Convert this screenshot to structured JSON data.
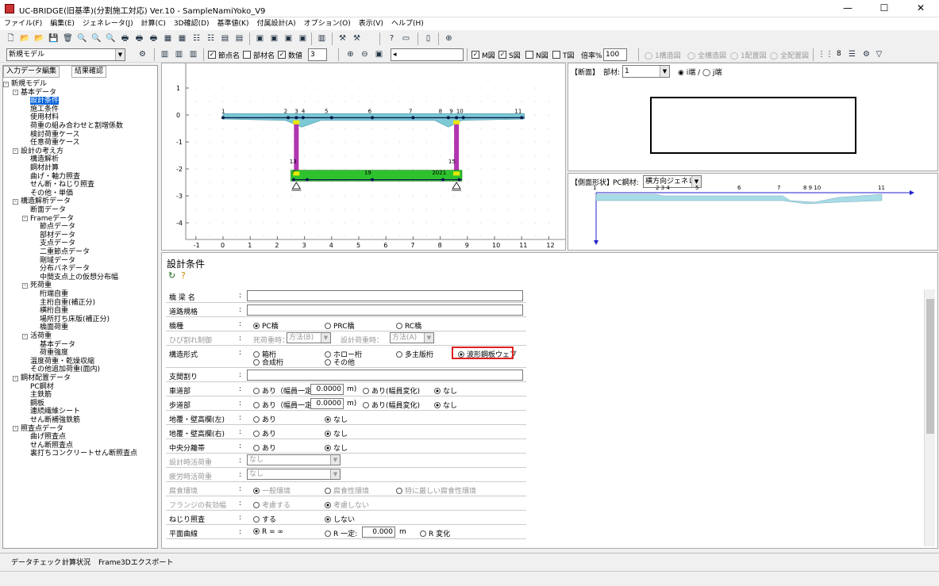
{
  "window": {
    "title": "UC-BRIDGE(旧基準)(分割施工対応) Ver.10 - SampleNamiYoko_V9",
    "minimize": "—",
    "maximize": "☐",
    "close": "✕"
  },
  "menu": [
    "ファイル(F)",
    "編集(E)",
    "ジェネレータ(J)",
    "計算(C)",
    "3D確認(D)",
    "基準値(K)",
    "付属設計(A)",
    "オプション(O)",
    "表示(V)",
    "ヘルプ(H)"
  ],
  "toolbar2": {
    "model_select": "新規モデル",
    "node_name": "節点名",
    "member_name": "部材名",
    "value": "数値",
    "value_count": "3",
    "m_label": "M図",
    "s_label": "S図",
    "n_label": "N図",
    "t_label": "T図",
    "scale_label": "倍率%",
    "scale_value": "100",
    "radio1": "1構造図",
    "radio2": "全構造図",
    "radio3": "1配置図",
    "radio4": "全配置図",
    "num8": "8"
  },
  "left_tabs": {
    "input": "入力データ編集",
    "result": "結果確認"
  },
  "tree": [
    {
      "label": "新規モデル",
      "level": 0,
      "pm": "-"
    },
    {
      "label": "基本データ",
      "level": 1,
      "pm": "-"
    },
    {
      "label": "設計条件",
      "level": 2,
      "selected": true
    },
    {
      "label": "施工条件",
      "level": 2
    },
    {
      "label": "使用材料",
      "level": 2
    },
    {
      "label": "荷重の組み合わせと割増係数",
      "level": 2
    },
    {
      "label": "検討荷重ケース",
      "level": 2
    },
    {
      "label": "任意荷重ケース",
      "level": 2
    },
    {
      "label": "設計の考え方",
      "level": 1,
      "pm": "-"
    },
    {
      "label": "構造解析",
      "level": 2
    },
    {
      "label": "鋼材計算",
      "level": 2
    },
    {
      "label": "曲げ・軸力照査",
      "level": 2
    },
    {
      "label": "せん断・ねじり照査",
      "level": 2
    },
    {
      "label": "その他・単価",
      "level": 2
    },
    {
      "label": "構造解析データ",
      "level": 1,
      "pm": "-"
    },
    {
      "label": "断面データ",
      "level": 2
    },
    {
      "label": "Frameデータ",
      "level": 2,
      "pm": "-"
    },
    {
      "label": "節点データ",
      "level": 3
    },
    {
      "label": "部材データ",
      "level": 3
    },
    {
      "label": "支点データ",
      "level": 3
    },
    {
      "label": "二重節点データ",
      "level": 3
    },
    {
      "label": "剛域データ",
      "level": 3
    },
    {
      "label": "分布バネデータ",
      "level": 3
    },
    {
      "label": "中間支点上の仮想分布幅",
      "level": 3
    },
    {
      "label": "死荷重",
      "level": 2,
      "pm": "-"
    },
    {
      "label": "桁端自重",
      "level": 3
    },
    {
      "label": "主桁自重(補正分)",
      "level": 3
    },
    {
      "label": "横桁自重",
      "level": 3
    },
    {
      "label": "場所打ち床版(補正分)",
      "level": 3
    },
    {
      "label": "橋面荷重",
      "level": 3
    },
    {
      "label": "活荷重",
      "level": 2,
      "pm": "-"
    },
    {
      "label": "基本データ",
      "level": 3
    },
    {
      "label": "荷重強度",
      "level": 3
    },
    {
      "label": "温度荷重・乾燥収縮",
      "level": 2
    },
    {
      "label": "その他追加荷重(面内)",
      "level": 2
    },
    {
      "label": "鋼材配置データ",
      "level": 1,
      "pm": "-"
    },
    {
      "label": "PC鋼材",
      "level": 2
    },
    {
      "label": "主鉄筋",
      "level": 2
    },
    {
      "label": "鋼板",
      "level": 2
    },
    {
      "label": "連続繊維シート",
      "level": 2
    },
    {
      "label": "せん断補強鉄筋",
      "level": 2
    },
    {
      "label": "照査点データ",
      "level": 1,
      "pm": "-"
    },
    {
      "label": "曲げ照査点",
      "level": 2
    },
    {
      "label": "せん断照査点",
      "level": 2
    },
    {
      "label": "裏打ちコンクリートせん断照査点",
      "level": 2
    }
  ],
  "view1": {
    "x_ticks": [
      "-1",
      "0",
      "1",
      "2",
      "3",
      "4",
      "5",
      "6",
      "7",
      "8",
      "9",
      "10",
      "11",
      "12"
    ],
    "y_ticks": [
      "1",
      "0",
      "-1",
      "-2",
      "-3",
      "-4"
    ],
    "top_nodes": [
      "1",
      "2",
      "3",
      "4",
      "5",
      "6",
      "7",
      "8",
      "9",
      "10",
      "11"
    ],
    "bottom_nodes": [
      "13",
      "15",
      "19",
      "2021",
      "6"
    ]
  },
  "view2": {
    "label": "【断面】",
    "member_label": "部材:",
    "member_value": "1",
    "radio_i": "i端",
    "radio_j": "j端"
  },
  "view3": {
    "label": "【側面形状】",
    "pc_label": "PC鋼材:",
    "pc_value": "横方向ジェネレ",
    "nodes": [
      "1",
      "2 3 4",
      "5",
      "6",
      "7",
      "8 9 10",
      "11"
    ]
  },
  "form": {
    "title": "設計条件",
    "rows": [
      {
        "label": "橋 梁 名",
        "type": "text",
        "value": ""
      },
      {
        "label": "道路規格",
        "type": "text",
        "value": ""
      },
      {
        "label": "橋種",
        "type": "radio",
        "options": [
          "PC橋",
          "PRC橋",
          "RC橋"
        ],
        "selected": 0
      },
      {
        "label": "ひび割れ制御",
        "type": "disabled",
        "t1": "死荷重時：",
        "v1": "方法(B)",
        "t2": "設計荷重時：",
        "v2": "方法(A)"
      },
      {
        "label": "構造形式",
        "type": "radio2",
        "options": [
          "箱桁",
          "ホロー桁",
          "多主版桁",
          "波形鋼板ウェブ",
          "合成桁",
          "その他"
        ],
        "selected": 3
      },
      {
        "label": "支間割り",
        "type": "text",
        "value": ""
      },
      {
        "label": "車道部",
        "type": "width",
        "o1": "あり（幅員一定:",
        "v": "0.0000",
        "unit": "m)",
        "o2": "あり(幅員変化)",
        "o3": "なし",
        "selected": 2
      },
      {
        "label": "歩道部",
        "type": "width",
        "o1": "あり（幅員一定:",
        "v": "0.0000",
        "unit": "m)",
        "o2": "あり(幅員変化)",
        "o3": "なし",
        "selected": 2
      },
      {
        "label": "地覆・壁高欄(左)",
        "type": "radio",
        "options": [
          "あり",
          "なし"
        ],
        "selected": 1
      },
      {
        "label": "地覆・壁高欄(右)",
        "type": "radio",
        "options": [
          "あり",
          "なし"
        ],
        "selected": 1
      },
      {
        "label": "中央分離帯",
        "type": "radio",
        "options": [
          "あり",
          "なし"
        ],
        "selected": 1
      },
      {
        "label": "設計時活荷重",
        "type": "select",
        "value": "なし"
      },
      {
        "label": "疲労時活荷重",
        "type": "select",
        "value": "なし"
      },
      {
        "label": "腐食環境",
        "type": "radiodis",
        "options": [
          "一般環境",
          "腐食性環境",
          "特に厳しい腐食性環境"
        ],
        "selected": 0
      },
      {
        "label": "フランジの有効幅",
        "type": "radiodis",
        "options": [
          "考慮する",
          "考慮しない"
        ],
        "selected": 1
      },
      {
        "label": "ねじり照査",
        "type": "radio",
        "options": [
          "する",
          "しない"
        ],
        "selected": 1
      },
      {
        "label": "平面曲線",
        "type": "curve",
        "o1": "R = ∞",
        "o2": "R 一定:",
        "v": "0.000",
        "unit": "m",
        "o3": "R 変化",
        "selected": 0
      }
    ]
  },
  "bottom_tabs": [
    "データチェック",
    "計算状況",
    "Frame3Dエクスポート"
  ]
}
